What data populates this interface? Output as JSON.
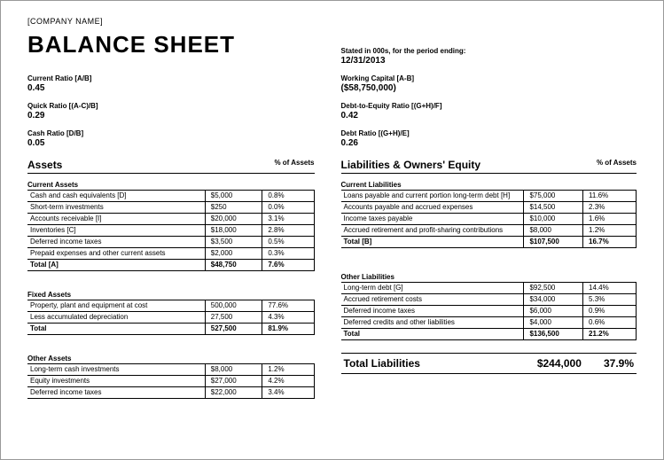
{
  "company": "[COMPANY NAME]",
  "title": "BALANCE SHEET",
  "period_note": "Stated in 000s, for the period ending:",
  "period_date": "12/31/2013",
  "ratios_left": [
    {
      "label": "Current Ratio   [A/B]",
      "value": "0.45"
    },
    {
      "label": "Quick Ratio   [(A-C)/B]",
      "value": "0.29"
    },
    {
      "label": "Cash Ratio   [D/B]",
      "value": "0.05"
    }
  ],
  "ratios_right": [
    {
      "label": "Working Capital   [A-B]",
      "value": "($58,750,000)"
    },
    {
      "label": "Debt-to-Equity Ratio   [(G+H)/F]",
      "value": "0.42"
    },
    {
      "label": "Debt Ratio   [(G+H)/E]",
      "value": "0.26"
    }
  ],
  "assets": {
    "header": "Assets",
    "pct_header": "% of Assets",
    "current": {
      "title": "Current Assets",
      "rows": [
        {
          "label": "Cash and cash equivalents  [D]",
          "value": "$5,000",
          "pct": "0.8%"
        },
        {
          "label": "Short-term investments",
          "value": "$250",
          "pct": "0.0%"
        },
        {
          "label": "Accounts receivable  [I]",
          "value": "$20,000",
          "pct": "3.1%"
        },
        {
          "label": "Inventories  [C]",
          "value": "$18,000",
          "pct": "2.8%"
        },
        {
          "label": "Deferred income taxes",
          "value": "$3,500",
          "pct": "0.5%"
        },
        {
          "label": "Prepaid expenses and other current assets",
          "value": "$2,000",
          "pct": "0.3%"
        }
      ],
      "total": {
        "label": "Total  [A]",
        "value": "$48,750",
        "pct": "7.6%"
      }
    },
    "fixed": {
      "title": "Fixed Assets",
      "rows": [
        {
          "label": "Property, plant and equipment at cost",
          "value": "500,000",
          "pct": "77.6%"
        },
        {
          "label": "Less accumulated depreciation",
          "value": "27,500",
          "pct": "4.3%"
        }
      ],
      "total": {
        "label": "Total",
        "value": "527,500",
        "pct": "81.9%"
      }
    },
    "other": {
      "title": "Other Assets",
      "rows": [
        {
          "label": "Long-term cash investments",
          "value": "$8,000",
          "pct": "1.2%"
        },
        {
          "label": "Equity investments",
          "value": "$27,000",
          "pct": "4.2%"
        },
        {
          "label": "Deferred income taxes",
          "value": "$22,000",
          "pct": "3.4%"
        }
      ]
    }
  },
  "liabilities": {
    "header": "Liabilities & Owners' Equity",
    "pct_header": "% of Assets",
    "current": {
      "title": "Current Liabilities",
      "rows": [
        {
          "label": "Loans payable and current portion long-term debt  [H]",
          "value": "$75,000",
          "pct": "11.6%"
        },
        {
          "label": "Accounts payable and accrued expenses",
          "value": "$14,500",
          "pct": "2.3%"
        },
        {
          "label": "Income taxes payable",
          "value": "$10,000",
          "pct": "1.6%"
        },
        {
          "label": "Accrued retirement and profit-sharing contributions",
          "value": "$8,000",
          "pct": "1.2%"
        }
      ],
      "total": {
        "label": "Total  [B]",
        "value": "$107,500",
        "pct": "16.7%"
      }
    },
    "other": {
      "title": "Other Liabilities",
      "rows": [
        {
          "label": "Long-term debt  [G]",
          "value": "$92,500",
          "pct": "14.4%"
        },
        {
          "label": "Accrued retirement costs",
          "value": "$34,000",
          "pct": "5.3%"
        },
        {
          "label": "Deferred income taxes",
          "value": "$6,000",
          "pct": "0.9%"
        },
        {
          "label": "Deferred credits and other liabilities",
          "value": "$4,000",
          "pct": "0.6%"
        }
      ],
      "total": {
        "label": "Total",
        "value": "$136,500",
        "pct": "21.2%"
      }
    },
    "grand_total": {
      "label": "Total Liabilities",
      "value": "$244,000",
      "pct": "37.9%"
    }
  }
}
